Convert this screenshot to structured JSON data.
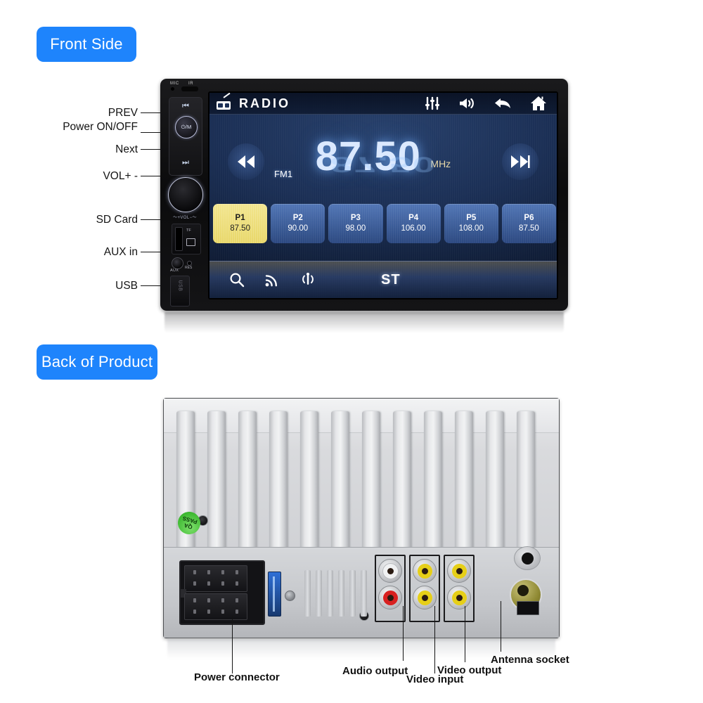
{
  "sections": {
    "front_badge": "Front Side",
    "back_badge": "Back of Product"
  },
  "front": {
    "bezel": {
      "mic": "MIC",
      "ir": "IR"
    },
    "controls": {
      "prev_glyph": "⏮",
      "next_glyph": "⏭",
      "power_label": "⏻/M",
      "vol_label": "〜+VOL−〜",
      "tf_label": "TF",
      "aux_label": "AUX",
      "res_label": "RES",
      "usb_label": "USB"
    },
    "callouts": [
      {
        "label": "PREV"
      },
      {
        "label": "Power ON/OFF"
      },
      {
        "label": "Next"
      },
      {
        "label": "VOL+ -"
      },
      {
        "label": "SD Card"
      },
      {
        "label": "AUX in"
      },
      {
        "label": "USB"
      }
    ],
    "screen": {
      "source_title": "RADIO",
      "source_icon": "radio-icon",
      "topbar_icons": [
        "equalizer-icon",
        "volume-icon",
        "back-arrow-icon",
        "home-icon"
      ],
      "band": "FM1",
      "frequency": "87.50",
      "unit": "MHz",
      "prev_glyph": "⏮",
      "next_glyph": "⏭",
      "presets": [
        {
          "name": "P1",
          "freq": "87.50",
          "active": true
        },
        {
          "name": "P2",
          "freq": "90.00",
          "active": false
        },
        {
          "name": "P3",
          "freq": "98.00",
          "active": false
        },
        {
          "name": "P4",
          "freq": "106.00",
          "active": false
        },
        {
          "name": "P5",
          "freq": "108.00",
          "active": false
        },
        {
          "name": "P6",
          "freq": "87.50",
          "active": false
        }
      ],
      "bottom_icons": [
        "search-icon",
        "signal-waves-icon",
        "broadcast-antenna-icon"
      ],
      "stereo_label": "ST"
    }
  },
  "back": {
    "qa_sticker": "QA PASS",
    "callouts": [
      {
        "label": "Power connector"
      },
      {
        "label": "Audio output"
      },
      {
        "label": "Video input"
      },
      {
        "label": "Video output"
      },
      {
        "label": "Antenna socket"
      }
    ],
    "jacks": {
      "audio_output": [
        "white",
        "red"
      ],
      "video_input": [
        "yellow",
        "yellow"
      ],
      "video_output": [
        "yellow",
        "yellow"
      ]
    }
  },
  "colors": {
    "badge_blue": "#1E84FC",
    "screen_navy": "#1b2f55",
    "preset_active": "#e8d768",
    "qa_green": "#3cb830",
    "antenna_gold": "#8f8933",
    "rca_red": "#d82020",
    "rca_yellow": "#e6cf18"
  }
}
